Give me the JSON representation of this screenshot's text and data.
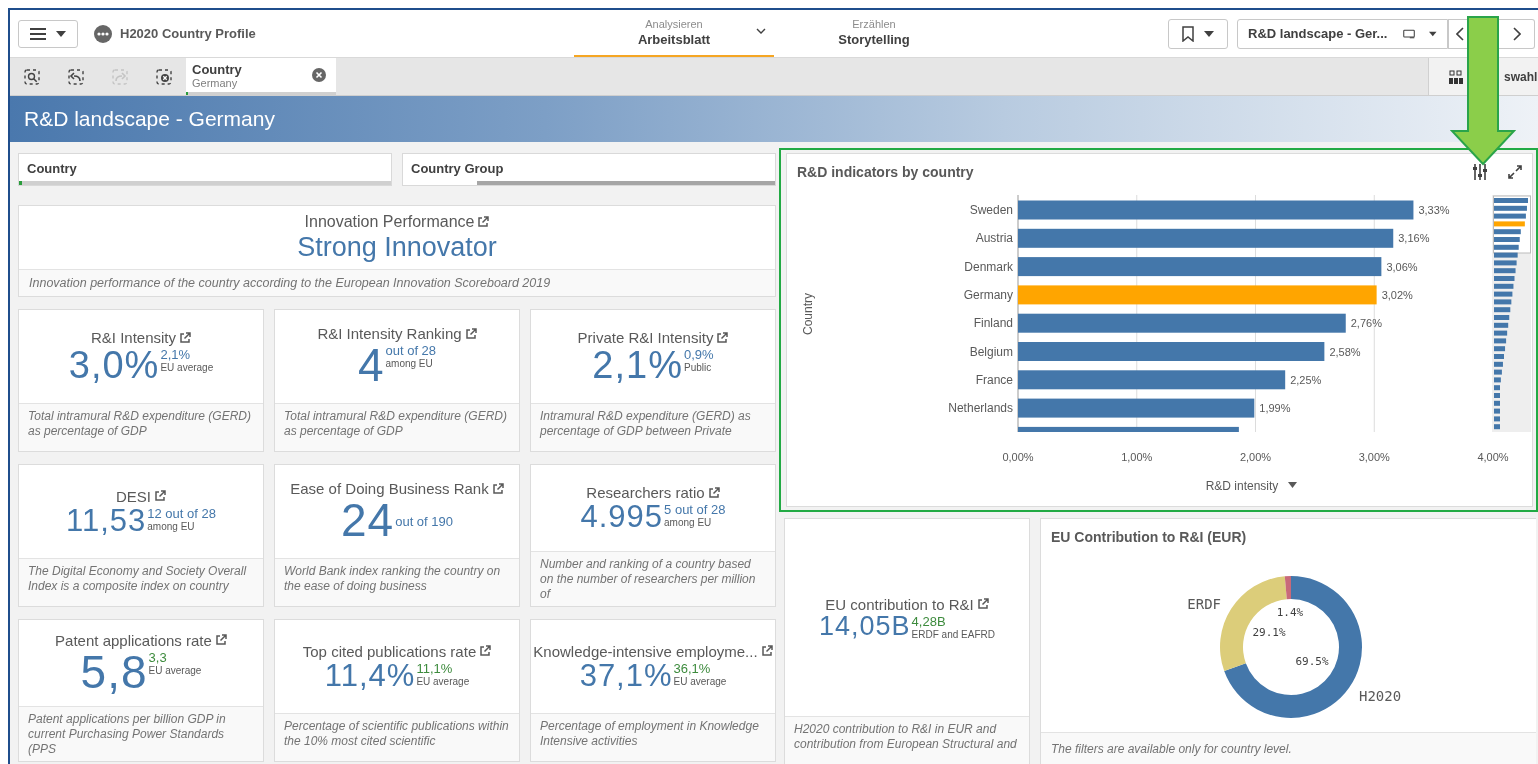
{
  "app": {
    "title": "H2020 Country Profile"
  },
  "mode_tabs": [
    {
      "caption": "Analysieren",
      "label": "Arbeitsblatt",
      "selected": true
    },
    {
      "caption": "Erzählen",
      "label": "Storytelling",
      "selected": false
    }
  ],
  "sheet_selector": {
    "label": "R&D landscape - Ger..."
  },
  "toolbar": {
    "tools": [
      {
        "kind": "search",
        "disabled": false
      },
      {
        "kind": "back",
        "disabled": false
      },
      {
        "kind": "forward",
        "disabled": true
      },
      {
        "kind": "clear",
        "disabled": false
      }
    ],
    "selections": [
      {
        "field": "Country",
        "value": "Germany"
      }
    ],
    "selections_button": {
      "label": "swahl"
    }
  },
  "sheet": {
    "title": "R&D landscape - Germany"
  },
  "filters": [
    {
      "label": "Country",
      "has_selection": true
    },
    {
      "label": "Country Group",
      "has_selection": false
    }
  ],
  "innovation": {
    "title": "Innovation Performance",
    "value": "Strong Innovator",
    "description": "Innovation performance of the country according to the European Innovation Scoreboard 2019"
  },
  "kpis": [
    {
      "kind": "medium",
      "title": "R&I Intensity",
      "value": "3,0%",
      "comparison": {
        "value": "2,1%",
        "label": "EU average",
        "color": "#4477aa"
      },
      "description": "Total intramural R&D expenditure (GERD) as percentage of GDP"
    },
    {
      "kind": "large",
      "title": "R&I Intensity Ranking",
      "value": "4",
      "comparison": {
        "value": "out of 28",
        "label": "among EU",
        "color": "#4477aa"
      },
      "description": "Total intramural R&D expenditure (GERD) as percentage of GDP"
    },
    {
      "kind": "medium",
      "title": "Private R&I Intensity",
      "value": "2,1%",
      "comparison": {
        "value": "0,9%",
        "label": "Public",
        "color": "#4477aa"
      },
      "description": "Intramural R&D expenditure (GERD) as percentage of GDP between Private"
    },
    {
      "kind": "small",
      "title": "DESI",
      "value": "11,53",
      "comparison": {
        "value": "12 out of 28",
        "label": "among EU",
        "color": "#4477aa"
      },
      "description": "The Digital Economy and Society Overall Index is a composite index on country"
    },
    {
      "kind": "large",
      "title": "Ease of Doing Business Rank",
      "value": "24",
      "comparison": {
        "value": "out of 190",
        "color": "#4477aa"
      },
      "description": "World Bank index ranking the country on the ease of doing business"
    },
    {
      "kind": "small",
      "title": "Researchers ratio",
      "value": "4.995",
      "comparison": {
        "value": "5 out of 28",
        "label": "among EU",
        "color": "#4477aa"
      },
      "description": "Number and ranking of a country based on the number of researchers per million of"
    },
    {
      "kind": "large",
      "title": "Patent applications rate",
      "value": "5,8",
      "comparison": {
        "value": "3,3",
        "label": "EU average",
        "color": "#3d8b3d"
      },
      "description": "Patent applications per billion GDP in current Purchasing Power Standards (PPS"
    },
    {
      "kind": "small",
      "title": "Top cited publications rate",
      "value": "11,4%",
      "comparison": {
        "value": "11,1%",
        "label": "EU average",
        "color": "#3d8b3d"
      },
      "description": "Percentage of scientific publications within the 10% most cited scientific"
    },
    {
      "kind": "small",
      "title": "Knowledge-intensive employme...",
      "value": "37,1%",
      "comparison": {
        "value": "36,1%",
        "label": "EU average",
        "color": "#3d8b3d"
      },
      "description": "Percentage of employment in Knowledge Intensive activities"
    }
  ],
  "chart": {
    "title": "R&D indicators by country",
    "chart_data": {
      "type": "bar",
      "orientation": "horizontal",
      "xlabel": "R&D intensity",
      "ylabel": "Country",
      "grid": true,
      "categories": [
        "Sweden",
        "Austria",
        "Denmark",
        "Germany",
        "Finland",
        "Belgium",
        "France",
        "Netherlands",
        null
      ],
      "values": [
        3.33,
        3.16,
        3.06,
        3.02,
        2.76,
        2.58,
        2.25,
        1.99,
        1.86
      ],
      "colors": [
        "#4477aa",
        "#4477aa",
        "#4477aa",
        "#ffa500",
        "#4477aa",
        "#4477aa",
        "#4477aa",
        "#4477aa",
        "#4477aa"
      ],
      "value_labels": [
        "3,33%",
        "3,16%",
        "3,06%",
        "3,02%",
        "2,76%",
        "2,58%",
        "2,25%",
        "1,99%",
        null
      ],
      "xlim": [
        0,
        4
      ],
      "xticks": [
        {
          "value": 0,
          "label": "0,00%"
        },
        {
          "value": 1,
          "label": "1,00%"
        },
        {
          "value": 2,
          "label": "2,00%"
        },
        {
          "value": 3,
          "label": "3,00%"
        },
        {
          "value": 4,
          "label": "4,00%"
        }
      ]
    }
  },
  "eu_contribution": {
    "kind": "xsmall",
    "title": "EU contribution to R&I",
    "value": "14,05B",
    "comparison": {
      "value": "4,28B",
      "label": "ERDF and EAFRD",
      "color": "#3d8b3d"
    },
    "description": "H2020 contribution to R&I in EUR and contribution from European Structural and"
  },
  "donut": {
    "title": "EU Contribution to R&I (EUR)",
    "chart_data": {
      "type": "donut",
      "categories": [
        "H2020",
        "ERDF",
        null
      ],
      "values": [
        69.5,
        29.1,
        1.4
      ],
      "colors": [
        "#4477aa",
        "#dccd7a",
        "#c8697a"
      ],
      "value_labels": [
        "69.5%",
        "29.1%",
        "1.4%"
      ]
    },
    "description": "The filters are available only for country level."
  }
}
